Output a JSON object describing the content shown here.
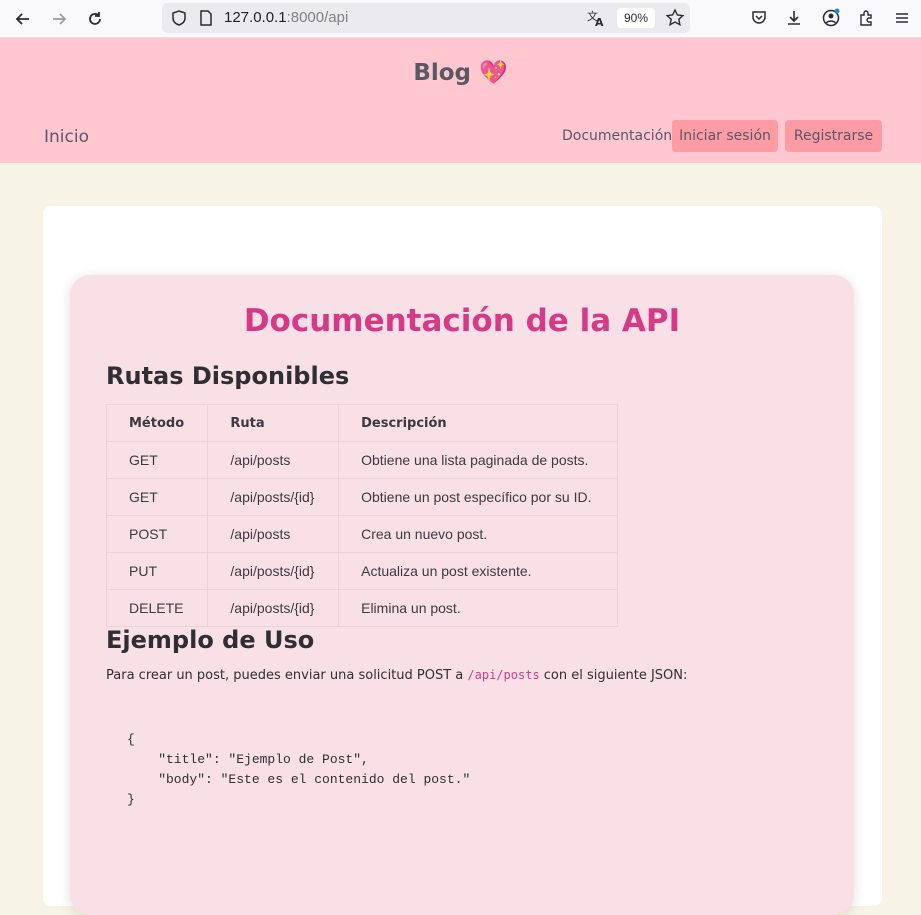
{
  "browser": {
    "url_host": "127.0.0.1",
    "url_path": ":8000/api",
    "zoom": "90%"
  },
  "header": {
    "title": "Blog 💖",
    "nav_home": "Inicio",
    "nav_docs": "Documentación",
    "login": "Iniciar sesión",
    "register": "Registrarse"
  },
  "doc": {
    "title": "Documentación de la API",
    "routes_heading": "Rutas Disponibles",
    "columns": [
      "Método",
      "Ruta",
      "Descripción"
    ],
    "rows": [
      [
        "GET",
        "/api/posts",
        "Obtiene una lista paginada de posts."
      ],
      [
        "GET",
        "/api/posts/{id}",
        "Obtiene un post específico por su ID."
      ],
      [
        "POST",
        "/api/posts",
        "Crea un nuevo post."
      ],
      [
        "PUT",
        "/api/posts/{id}",
        "Actualiza un post existente."
      ],
      [
        "DELETE",
        "/api/posts/{id}",
        "Elimina un post."
      ]
    ],
    "usage_heading": "Ejemplo de Uso",
    "usage_before": "Para crear un post, puedes enviar una solicitud POST a ",
    "usage_code": "/api/posts",
    "usage_after": " con el siguiente JSON:",
    "code_sample": "{\n    \"title\": \"Ejemplo de Post\",\n    \"body\": \"Este es el contenido del post.\"\n}"
  }
}
